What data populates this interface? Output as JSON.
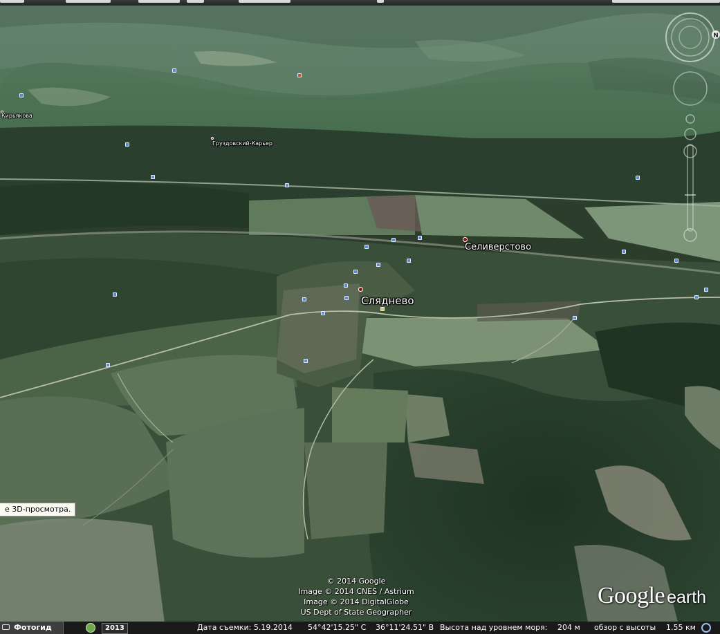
{
  "places": {
    "kiryakovo": "Кирьякова",
    "gruzdovsky": "Груздовский-Карьер",
    "seliverstovo": "Селиверстово",
    "slyadnevo": "Сляднево"
  },
  "tooltip": "е 3D-просмотра.",
  "attribution": {
    "line1": "© 2014 Google",
    "line2": "Image © 2014 CNES / Astrium",
    "line3": "Image © 2014 DigitalGlobe",
    "line4": "US Dept of State Geographer"
  },
  "logo": {
    "google": "Google",
    "earth": "earth"
  },
  "nav": {
    "north_letter": "N"
  },
  "statusbar": {
    "photo_label": "Фотогид",
    "year": "2013",
    "capture_date": "Дата съемки: 5.19.2014",
    "latitude": "54°42'15.25\" С",
    "longitude": "36°11'24.51\" В",
    "elevation_label": "Высота над уровнем моря:",
    "elevation_value": "204 м",
    "eye_alt_label": "обзор с высоты",
    "eye_alt_value": "1.55 км"
  },
  "colors": {
    "place_dot": "#8a1010",
    "poi_blue": "#5b8bd8",
    "status_bg": "#1a1a1a"
  },
  "icons": {
    "compass": "compass-ring-icon",
    "look": "look-joystick-icon",
    "zoom": "zoom-slider-icon",
    "photo": "camera-icon",
    "clock": "historical-imagery-clock-icon",
    "search": "search-icon"
  }
}
